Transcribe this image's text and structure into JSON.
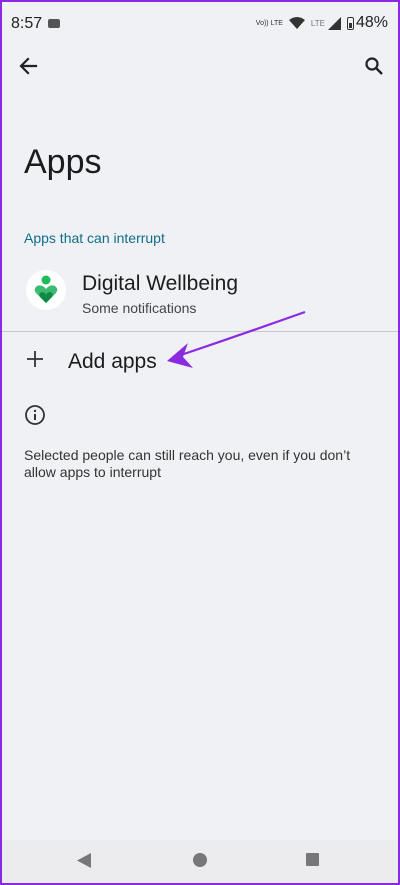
{
  "status_bar": {
    "time": "8:57",
    "volte_label": "Vo)) LTE",
    "lte_label": "LTE",
    "battery": "48%"
  },
  "top_bar": {
    "back_icon": "arrow-back-icon",
    "search_icon": "search-icon"
  },
  "page": {
    "title": "Apps",
    "section_header": "Apps that can interrupt"
  },
  "apps": [
    {
      "name": "Digital Wellbeing",
      "summary": "Some notifications",
      "icon": "digital-wellbeing-icon"
    }
  ],
  "add_apps": {
    "label": "Add apps",
    "icon": "plus-icon"
  },
  "info": {
    "icon": "info-icon",
    "text": "Selected people can still reach you, even if you don’t allow apps to interrupt"
  },
  "colors": {
    "accent": "#116c8a",
    "annotation": "#8a2be2",
    "background": "#f0f1f4"
  }
}
